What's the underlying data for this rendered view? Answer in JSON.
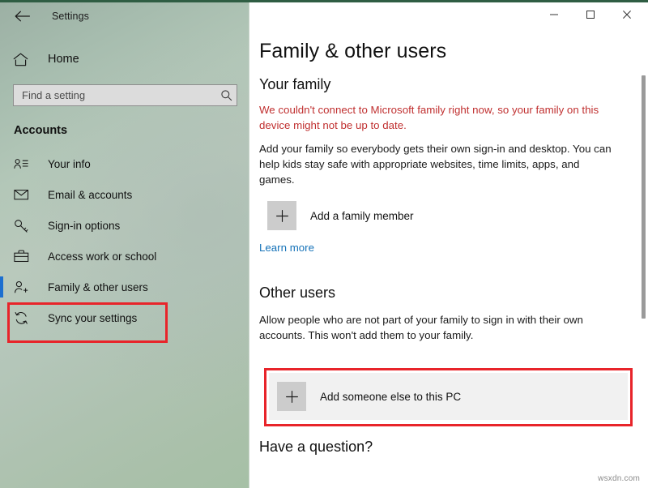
{
  "window": {
    "app_title": "Settings",
    "back_icon": "back-arrow-icon",
    "controls": {
      "minimize": "minimize-icon",
      "maximize": "maximize-icon",
      "close": "close-icon"
    }
  },
  "sidebar": {
    "home_label": "Home",
    "home_icon": "home-icon",
    "search": {
      "placeholder": "Find a setting",
      "value": "",
      "icon": "search-icon"
    },
    "category": "Accounts",
    "selected_index": 4,
    "items": [
      {
        "label": "Your info",
        "icon": "user-info-icon"
      },
      {
        "label": "Email & accounts",
        "icon": "envelope-icon"
      },
      {
        "label": "Sign-in options",
        "icon": "key-icon"
      },
      {
        "label": "Access work or school",
        "icon": "briefcase-icon"
      },
      {
        "label": "Family & other users",
        "icon": "user-add-icon"
      },
      {
        "label": "Sync your settings",
        "icon": "sync-icon"
      }
    ]
  },
  "main": {
    "page_title": "Family & other users",
    "your_family": {
      "heading": "Your family",
      "error_text": "We couldn't connect to Microsoft family right now, so your family on this device might not be up to date.",
      "description": "Add your family so everybody gets their own sign-in and desktop. You can help kids stay safe with appropriate websites, time limits, apps, and games.",
      "add_button_label": "Add a family member",
      "add_button_icon": "plus-icon",
      "learn_more_label": "Learn more"
    },
    "other_users": {
      "heading": "Other users",
      "description": "Allow people who are not part of your family to sign in with their own accounts. This won't add them to your family.",
      "add_button_label": "Add someone else to this PC",
      "add_button_icon": "plus-icon"
    },
    "question_heading": "Have a question?"
  },
  "annotations": {
    "highlight_color": "#e8242a",
    "selection_color": "#1d6fd0"
  },
  "watermark": "wsxdn.com"
}
